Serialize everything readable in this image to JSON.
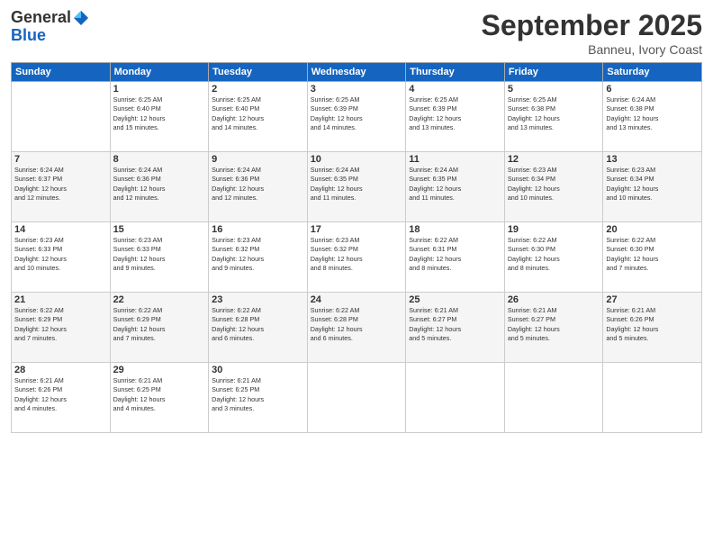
{
  "header": {
    "logo_line1": "General",
    "logo_line2": "Blue",
    "month": "September 2025",
    "location": "Banneu, Ivory Coast"
  },
  "days_of_week": [
    "Sunday",
    "Monday",
    "Tuesday",
    "Wednesday",
    "Thursday",
    "Friday",
    "Saturday"
  ],
  "weeks": [
    [
      {
        "day": "",
        "info": ""
      },
      {
        "day": "1",
        "info": "Sunrise: 6:25 AM\nSunset: 6:40 PM\nDaylight: 12 hours\nand 15 minutes."
      },
      {
        "day": "2",
        "info": "Sunrise: 6:25 AM\nSunset: 6:40 PM\nDaylight: 12 hours\nand 14 minutes."
      },
      {
        "day": "3",
        "info": "Sunrise: 6:25 AM\nSunset: 6:39 PM\nDaylight: 12 hours\nand 14 minutes."
      },
      {
        "day": "4",
        "info": "Sunrise: 6:25 AM\nSunset: 6:39 PM\nDaylight: 12 hours\nand 13 minutes."
      },
      {
        "day": "5",
        "info": "Sunrise: 6:25 AM\nSunset: 6:38 PM\nDaylight: 12 hours\nand 13 minutes."
      },
      {
        "day": "6",
        "info": "Sunrise: 6:24 AM\nSunset: 6:38 PM\nDaylight: 12 hours\nand 13 minutes."
      }
    ],
    [
      {
        "day": "7",
        "info": "Sunrise: 6:24 AM\nSunset: 6:37 PM\nDaylight: 12 hours\nand 12 minutes."
      },
      {
        "day": "8",
        "info": "Sunrise: 6:24 AM\nSunset: 6:36 PM\nDaylight: 12 hours\nand 12 minutes."
      },
      {
        "day": "9",
        "info": "Sunrise: 6:24 AM\nSunset: 6:36 PM\nDaylight: 12 hours\nand 12 minutes."
      },
      {
        "day": "10",
        "info": "Sunrise: 6:24 AM\nSunset: 6:35 PM\nDaylight: 12 hours\nand 11 minutes."
      },
      {
        "day": "11",
        "info": "Sunrise: 6:24 AM\nSunset: 6:35 PM\nDaylight: 12 hours\nand 11 minutes."
      },
      {
        "day": "12",
        "info": "Sunrise: 6:23 AM\nSunset: 6:34 PM\nDaylight: 12 hours\nand 10 minutes."
      },
      {
        "day": "13",
        "info": "Sunrise: 6:23 AM\nSunset: 6:34 PM\nDaylight: 12 hours\nand 10 minutes."
      }
    ],
    [
      {
        "day": "14",
        "info": "Sunrise: 6:23 AM\nSunset: 6:33 PM\nDaylight: 12 hours\nand 10 minutes."
      },
      {
        "day": "15",
        "info": "Sunrise: 6:23 AM\nSunset: 6:33 PM\nDaylight: 12 hours\nand 9 minutes."
      },
      {
        "day": "16",
        "info": "Sunrise: 6:23 AM\nSunset: 6:32 PM\nDaylight: 12 hours\nand 9 minutes."
      },
      {
        "day": "17",
        "info": "Sunrise: 6:23 AM\nSunset: 6:32 PM\nDaylight: 12 hours\nand 8 minutes."
      },
      {
        "day": "18",
        "info": "Sunrise: 6:22 AM\nSunset: 6:31 PM\nDaylight: 12 hours\nand 8 minutes."
      },
      {
        "day": "19",
        "info": "Sunrise: 6:22 AM\nSunset: 6:30 PM\nDaylight: 12 hours\nand 8 minutes."
      },
      {
        "day": "20",
        "info": "Sunrise: 6:22 AM\nSunset: 6:30 PM\nDaylight: 12 hours\nand 7 minutes."
      }
    ],
    [
      {
        "day": "21",
        "info": "Sunrise: 6:22 AM\nSunset: 6:29 PM\nDaylight: 12 hours\nand 7 minutes."
      },
      {
        "day": "22",
        "info": "Sunrise: 6:22 AM\nSunset: 6:29 PM\nDaylight: 12 hours\nand 7 minutes."
      },
      {
        "day": "23",
        "info": "Sunrise: 6:22 AM\nSunset: 6:28 PM\nDaylight: 12 hours\nand 6 minutes."
      },
      {
        "day": "24",
        "info": "Sunrise: 6:22 AM\nSunset: 6:28 PM\nDaylight: 12 hours\nand 6 minutes."
      },
      {
        "day": "25",
        "info": "Sunrise: 6:21 AM\nSunset: 6:27 PM\nDaylight: 12 hours\nand 5 minutes."
      },
      {
        "day": "26",
        "info": "Sunrise: 6:21 AM\nSunset: 6:27 PM\nDaylight: 12 hours\nand 5 minutes."
      },
      {
        "day": "27",
        "info": "Sunrise: 6:21 AM\nSunset: 6:26 PM\nDaylight: 12 hours\nand 5 minutes."
      }
    ],
    [
      {
        "day": "28",
        "info": "Sunrise: 6:21 AM\nSunset: 6:26 PM\nDaylight: 12 hours\nand 4 minutes."
      },
      {
        "day": "29",
        "info": "Sunrise: 6:21 AM\nSunset: 6:25 PM\nDaylight: 12 hours\nand 4 minutes."
      },
      {
        "day": "30",
        "info": "Sunrise: 6:21 AM\nSunset: 6:25 PM\nDaylight: 12 hours\nand 3 minutes."
      },
      {
        "day": "",
        "info": ""
      },
      {
        "day": "",
        "info": ""
      },
      {
        "day": "",
        "info": ""
      },
      {
        "day": "",
        "info": ""
      }
    ]
  ]
}
